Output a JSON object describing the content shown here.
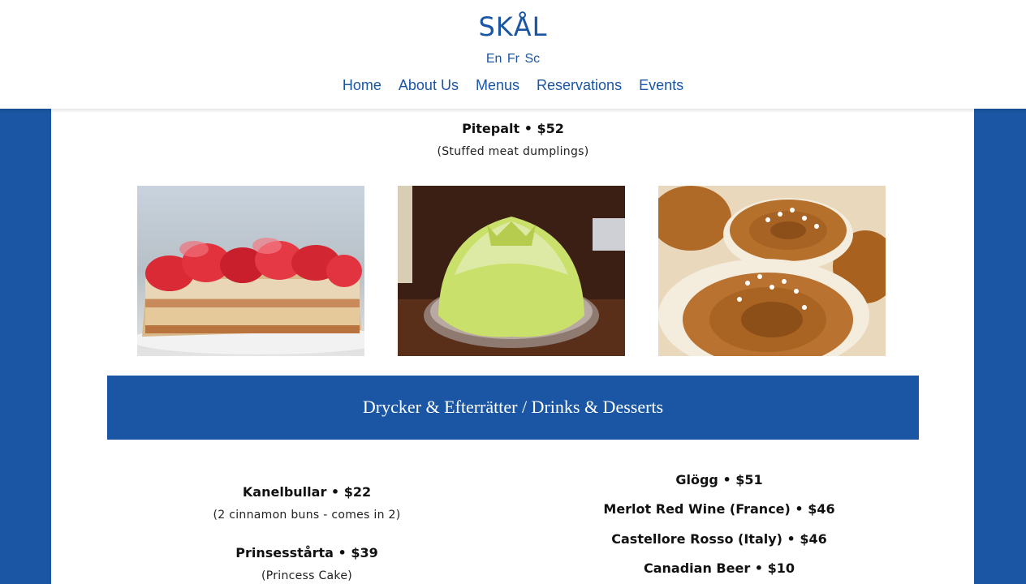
{
  "site": {
    "logo": "SKÅL",
    "languages": [
      "En",
      "Fr",
      "Sc"
    ],
    "nav": [
      "Home",
      "About Us",
      "Menus",
      "Reservations",
      "Events"
    ]
  },
  "top_item": {
    "name": "Pitepalt • $52",
    "desc": "(Stuffed meat dumplings)"
  },
  "photos": [
    {
      "subject": "strawberry cake slice"
    },
    {
      "subject": "princess cake"
    },
    {
      "subject": "cinnamon buns"
    }
  ],
  "section": {
    "title": "Drycker & Efterrätter / Drinks & Desserts"
  },
  "desserts": [
    {
      "name": "Kanelbullar • $22",
      "desc": "(2 cinnamon buns - comes in 2)"
    },
    {
      "name": "Prinsesstårta • $39",
      "desc": "(Princess Cake)"
    }
  ],
  "drinks": [
    {
      "name": "Glögg • $51"
    },
    {
      "name": "Merlot Red Wine (France) • $46"
    },
    {
      "name": "Castellore Rosso (Italy) • $46"
    },
    {
      "name": "Canadian Beer • $10"
    }
  ],
  "colors": {
    "brand_blue": "#1a56a3",
    "white": "#ffffff"
  }
}
